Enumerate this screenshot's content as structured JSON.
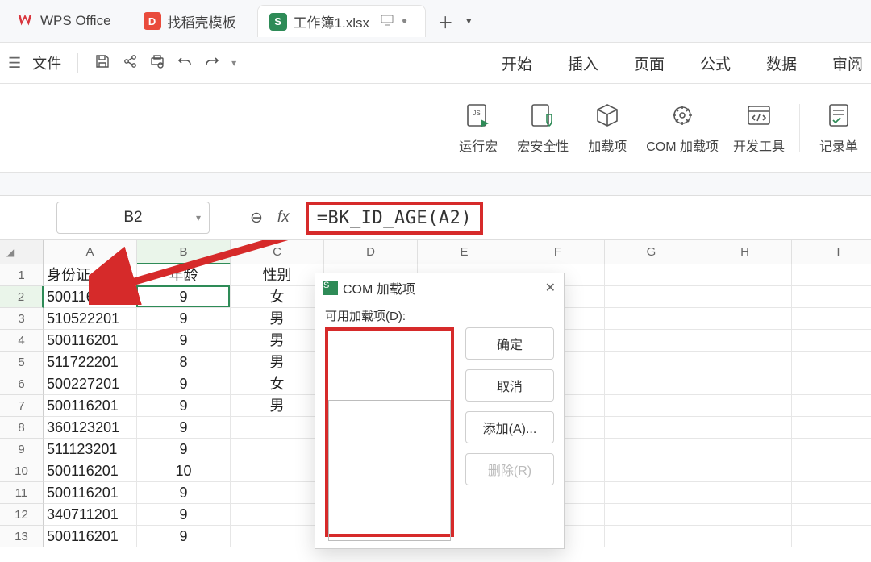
{
  "tabs": {
    "wps_label": "WPS Office",
    "docer_label": "找稻壳模板",
    "doc_label": "工作簿1.xlsx"
  },
  "toolbar": {
    "file_label": "文件"
  },
  "menubar": {
    "start": "开始",
    "insert": "插入",
    "page": "页面",
    "formula": "公式",
    "data": "数据",
    "review": "审阅"
  },
  "ribbon": {
    "run_macro": "运行宏",
    "macro_security": "宏安全性",
    "addins": "加载项",
    "com_addins": "COM 加载项",
    "dev_tools": "开发工具",
    "record_sheet": "记录单"
  },
  "formula_bar": {
    "cell_ref": "B2",
    "formula": "=BK_ID_AGE(A2)",
    "minus": "⊖",
    "fx": "fx"
  },
  "sheet": {
    "select_all_hint": "◢",
    "columns": [
      "A",
      "B",
      "C",
      "D",
      "E",
      "F",
      "G",
      "H",
      "I"
    ],
    "headers": {
      "A": "身份证",
      "B": "年龄",
      "C": "性别"
    },
    "rows": [
      {
        "r": "1",
        "A": "身份证",
        "B": "年龄",
        "C": "性别"
      },
      {
        "r": "2",
        "A": "500116201",
        "B": "9",
        "C": "女"
      },
      {
        "r": "3",
        "A": "510522201",
        "B": "9",
        "C": "男"
      },
      {
        "r": "4",
        "A": "500116201",
        "B": "9",
        "C": "男"
      },
      {
        "r": "5",
        "A": "511722201",
        "B": "8",
        "C": "男"
      },
      {
        "r": "6",
        "A": "500227201",
        "B": "9",
        "C": "女"
      },
      {
        "r": "7",
        "A": "500116201",
        "B": "9",
        "C": "男"
      },
      {
        "r": "8",
        "A": "360123201",
        "B": "9",
        "C": ""
      },
      {
        "r": "9",
        "A": "511123201",
        "B": "9",
        "C": ""
      },
      {
        "r": "10",
        "A": "500116201",
        "B": "10",
        "C": ""
      },
      {
        "r": "11",
        "A": "500116201",
        "B": "9",
        "C": ""
      },
      {
        "r": "12",
        "A": "340711201",
        "B": "9",
        "C": ""
      },
      {
        "r": "13",
        "A": "500116201",
        "B": "9",
        "C": ""
      }
    ],
    "selected": {
      "row": 2,
      "col": "B"
    }
  },
  "dialog": {
    "title": "COM 加载项",
    "list_label": "可用加载项(D):",
    "ok": "确定",
    "cancel": "取消",
    "add": "添加(A)...",
    "remove": "删除(R)"
  }
}
